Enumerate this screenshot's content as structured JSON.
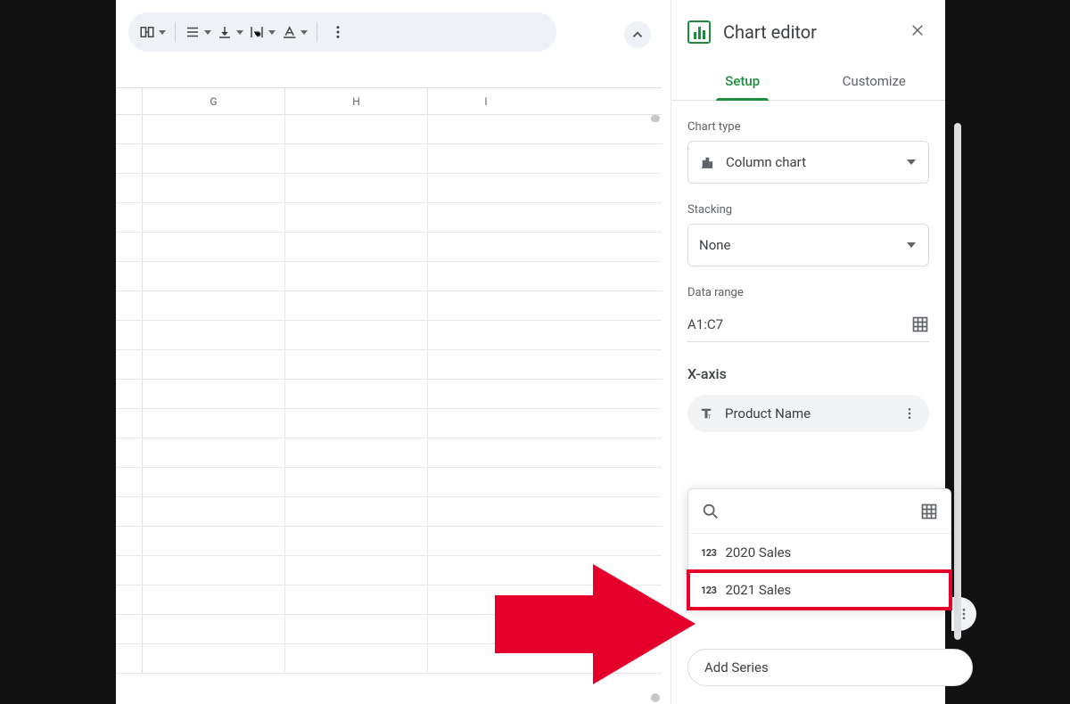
{
  "toolbar": {
    "merge_icon": "merge-cells-icon",
    "halign_icon": "horizontal-align-icon",
    "valign_icon": "vertical-align-icon",
    "wrap_icon": "text-wrap-icon",
    "rotate_icon": "text-rotate-icon",
    "more_icon": "more-vert-icon",
    "collapse_icon": "chevron-up-icon"
  },
  "sheet": {
    "columns": [
      "G",
      "H",
      "I"
    ]
  },
  "panel": {
    "title": "Chart editor",
    "tabs": {
      "setup": "Setup",
      "customize": "Customize",
      "active": "setup"
    },
    "chart_type": {
      "label": "Chart type",
      "value": "Column chart"
    },
    "stacking": {
      "label": "Stacking",
      "value": "None"
    },
    "data_range": {
      "label": "Data range",
      "value": "A1:C7"
    },
    "x_axis": {
      "title": "X-axis",
      "value": "Product Name"
    },
    "series_picker": {
      "search_placeholder": "",
      "items": [
        {
          "type": "number",
          "label": "2020 Sales",
          "highlighted": false
        },
        {
          "type": "number",
          "label": "2021 Sales",
          "highlighted": true
        }
      ]
    },
    "add_series_label": "Add Series"
  }
}
